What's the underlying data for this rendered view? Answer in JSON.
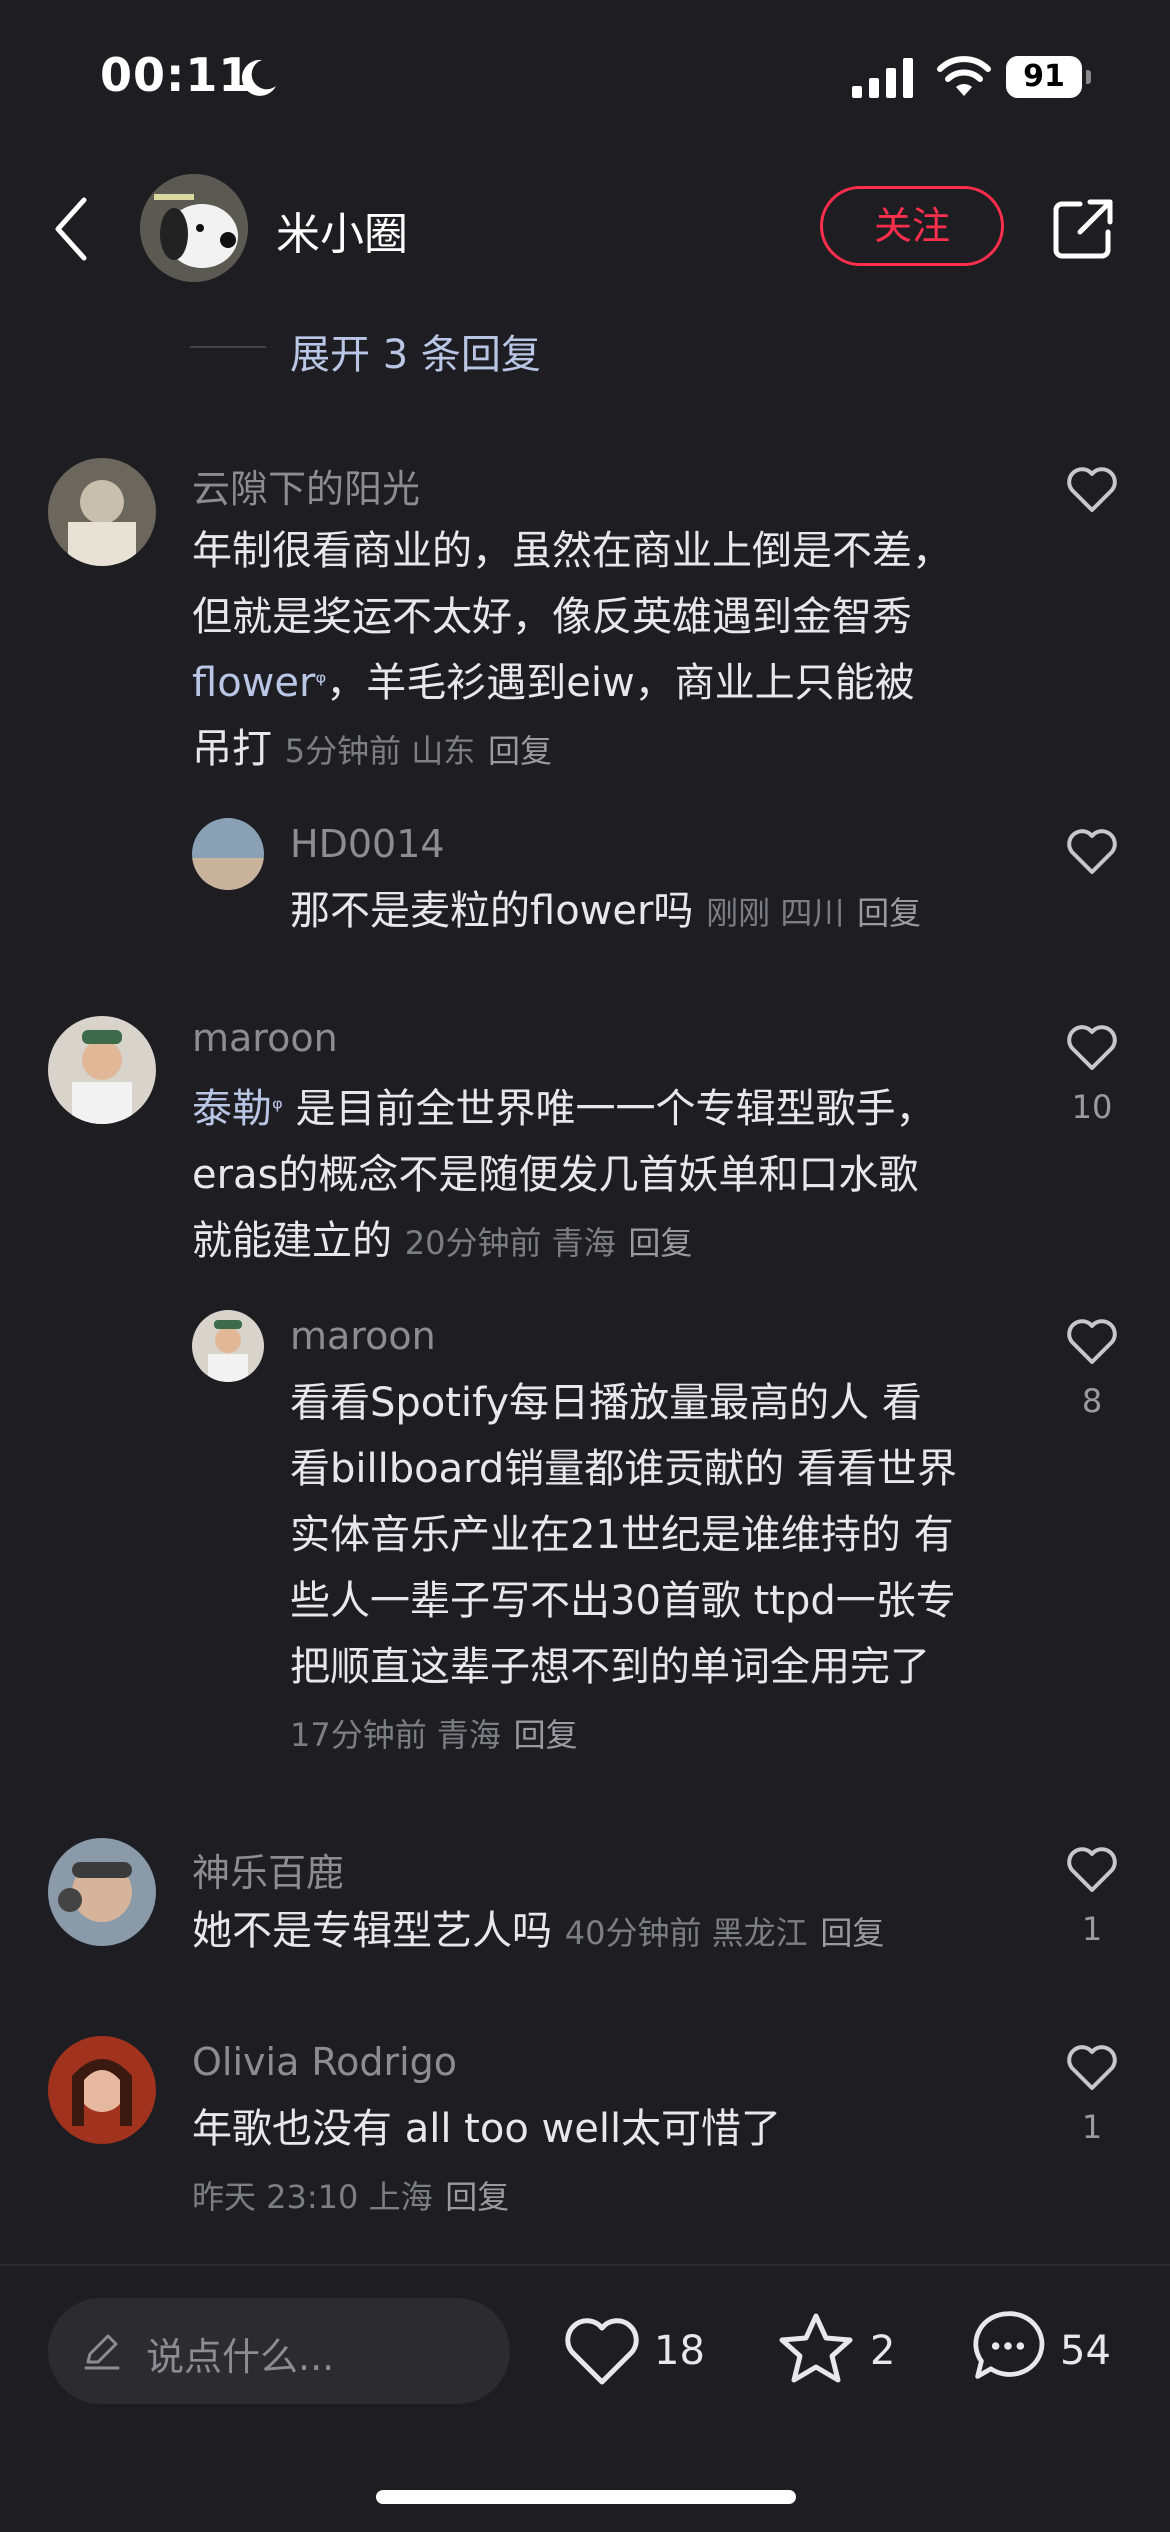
{
  "status_bar": {
    "time": "00:11",
    "battery": "91"
  },
  "header": {
    "author": "米小圈",
    "follow_label": "关注"
  },
  "expand_replies": "展开 3 条回复",
  "comments": [
    {
      "user": "云隙下的阳光",
      "text_lines": [
        "年制很看商业的，虽然在商业上倒是不差，",
        "但就是奖运不太好，像反英雄遇到金智秀",
        "，羊毛衫遇到eiw，商业上只能被",
        "吊打"
      ],
      "link": "flower",
      "meta": "5分钟前 山东",
      "reply": "回复",
      "likes": ""
    },
    {
      "user": "HD0014",
      "text": "那不是麦粒的flower吗",
      "meta": "刚刚 四川",
      "reply": "回复",
      "likes": ""
    },
    {
      "user": "maroon",
      "link": "泰勒",
      "text_lines": [
        " 是目前全世界唯一一个专辑型歌手，",
        "eras的概念不是随便发几首妖单和口水歌",
        "就能建立的"
      ],
      "meta": "20分钟前 青海",
      "reply": "回复",
      "likes": "10"
    },
    {
      "user": "maroon",
      "text_lines": [
        "看看Spotify每日播放量最高的人 看",
        "看billboard销量都谁贡献的 看看世界",
        "实体音乐产业在21世纪是谁维持的 有",
        "些人一辈子写不出30首歌 ttpd一张专",
        "把顺直这辈子想不到的单词全用完了"
      ],
      "meta": "17分钟前 青海",
      "reply": "回复",
      "likes": "8"
    },
    {
      "user": "神乐百鹿",
      "text": "她不是专辑型艺人吗",
      "meta": "40分钟前 黑龙江",
      "reply": "回复",
      "likes": "1"
    },
    {
      "user": "Olivia Rodrigo",
      "text": "年歌也没有 all too well太可惜了",
      "meta": "昨天 23:10 上海",
      "reply": "回复",
      "likes": "1"
    }
  ],
  "bottom_bar": {
    "input_placeholder": "说点什么...",
    "like_count": "18",
    "star_count": "2",
    "comment_count": "54"
  }
}
